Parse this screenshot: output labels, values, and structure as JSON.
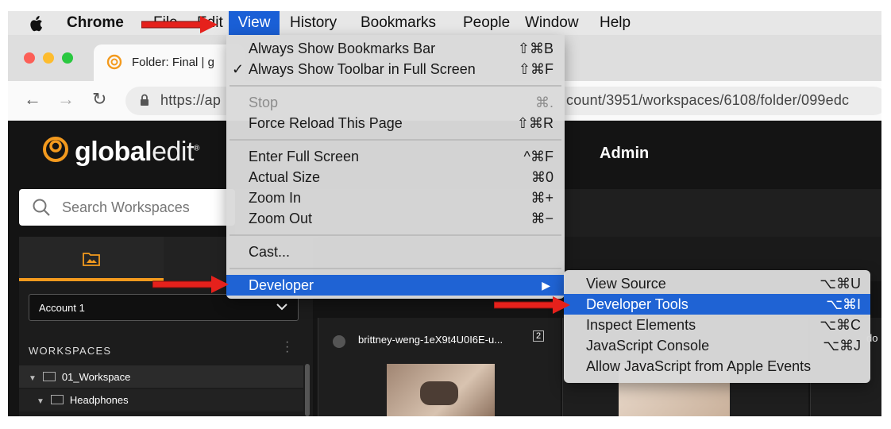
{
  "menubar": {
    "app_name": "Chrome",
    "items": [
      "File",
      "Edit",
      "View",
      "History",
      "Bookmarks",
      "People",
      "Window",
      "Help"
    ]
  },
  "browser": {
    "tab_title": "Folder: Final | g",
    "url": "https://ap",
    "url_tail": "count/3951/workspaces/6108/folder/099edc"
  },
  "page": {
    "brand_bold": "global",
    "brand_thin": "edit",
    "brand_mark": "®",
    "admin_label": "Admin",
    "search_placeholder": "Search Workspaces",
    "account_value": "Account 1",
    "workspaces_label": "WORKSPACES",
    "tree": [
      {
        "label": "01_Workspace"
      },
      {
        "label": "Headphones"
      }
    ],
    "card1_name": "brittney-weng-1eX9t4U0I6E-u...",
    "card1_count": "2",
    "card3_cut": "do"
  },
  "view_menu": {
    "items": [
      {
        "label": "Always Show Bookmarks Bar",
        "shortcut": "⇧⌘B"
      },
      {
        "label": "Always Show Toolbar in Full Screen",
        "shortcut": "⇧⌘F",
        "checked": "✓"
      },
      {
        "label": "Stop",
        "shortcut": "⌘.",
        "disabled": true
      },
      {
        "label": "Force Reload This Page",
        "shortcut": "⇧⌘R"
      },
      {
        "label": "Enter Full Screen",
        "shortcut": "^⌘F"
      },
      {
        "label": "Actual Size",
        "shortcut": "⌘0"
      },
      {
        "label": "Zoom In",
        "shortcut": "⌘+"
      },
      {
        "label": "Zoom Out",
        "shortcut": "⌘−"
      },
      {
        "label": "Cast..."
      },
      {
        "label": "Developer",
        "submenu_arrow": "▶",
        "highlighted": true
      }
    ]
  },
  "developer_menu": {
    "items": [
      {
        "label": "View Source",
        "shortcut": "⌥⌘U"
      },
      {
        "label": "Developer Tools",
        "shortcut": "⌥⌘I",
        "highlighted": true
      },
      {
        "label": "Inspect Elements",
        "shortcut": "⌥⌘C"
      },
      {
        "label": "JavaScript Console",
        "shortcut": "⌥⌘J"
      },
      {
        "label": "Allow JavaScript from Apple Events"
      }
    ]
  },
  "colors": {
    "menu_highlight": "#1f63d4",
    "accent_orange": "#f39a1e",
    "annotation_red": "#e5211c"
  },
  "icons": [
    "apple-icon",
    "favicon-icon",
    "back-icon",
    "forward-icon",
    "reload-icon",
    "lock-icon",
    "search-icon",
    "folder-image-icon",
    "chevron-down-icon",
    "kebab-icon",
    "folder-icon",
    "check-icon",
    "submenu-arrow-icon"
  ]
}
